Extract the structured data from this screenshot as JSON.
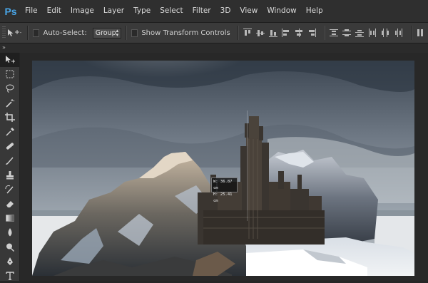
{
  "app": {
    "logo": "Ps",
    "brand_color": "#49a5e6"
  },
  "menu": {
    "items": [
      "File",
      "Edit",
      "Image",
      "Layer",
      "Type",
      "Select",
      "Filter",
      "3D",
      "View",
      "Window",
      "Help"
    ]
  },
  "options": {
    "tool_icon": "move-tool-icon",
    "auto_select_label": "Auto-Select:",
    "auto_select_checked": false,
    "auto_select_value": "Group",
    "transform_label": "Show Transform Controls",
    "transform_checked": false
  },
  "tools": [
    "move",
    "marquee",
    "lasso",
    "quick-select",
    "crop",
    "eyedropper",
    "healing-brush",
    "brush",
    "clone-stamp",
    "history-brush",
    "eraser",
    "gradient",
    "blur",
    "dodge",
    "pen",
    "type"
  ],
  "canvas": {
    "measure_w": "W: 36.87 cm",
    "measure_h": "H: 25.41 cm"
  }
}
